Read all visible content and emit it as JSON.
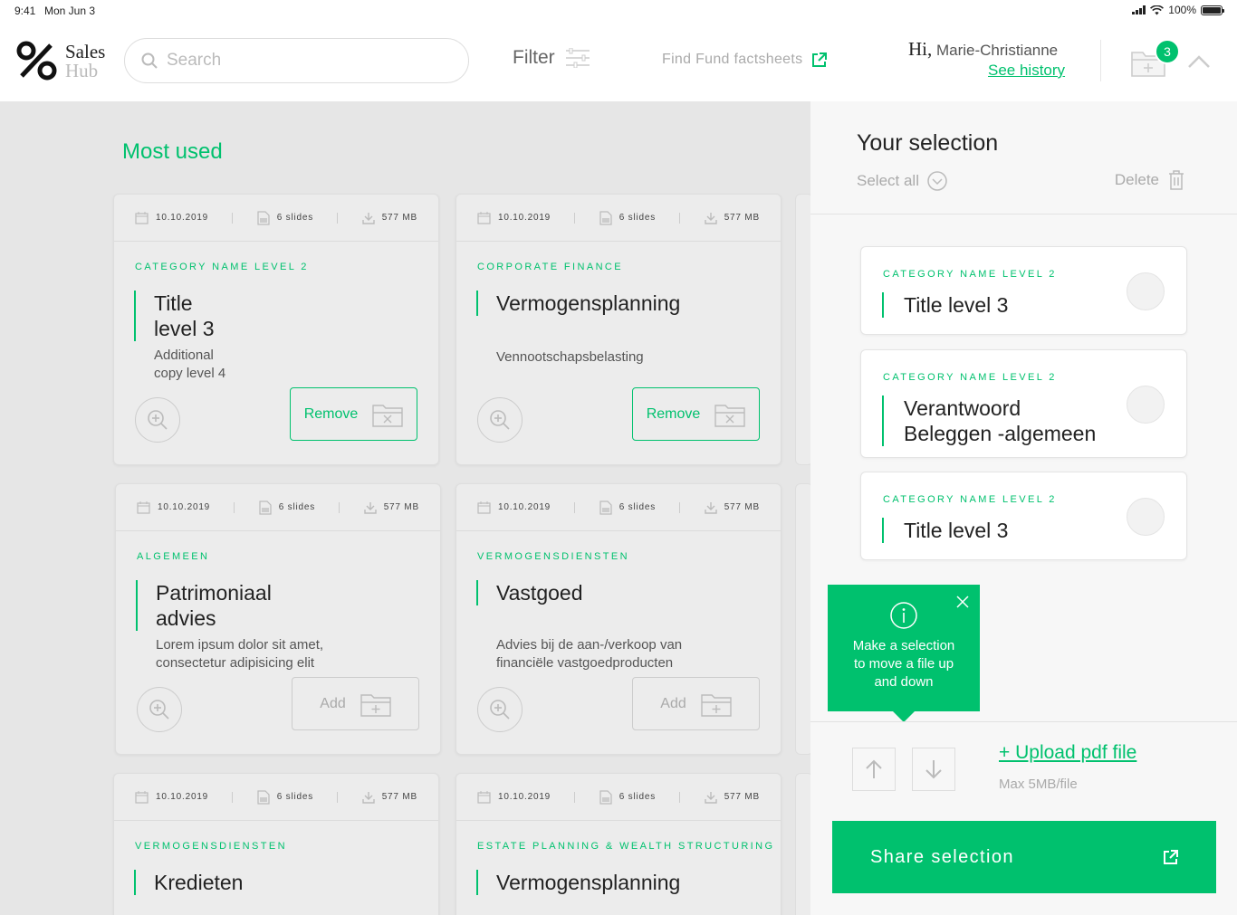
{
  "status_bar": {
    "time": "9:41",
    "date": "Mon Jun 3",
    "battery": "100%"
  },
  "header": {
    "brand_top": "Sales",
    "brand_bottom": "Hub",
    "search_placeholder": "Search",
    "filter_label": "Filter",
    "factsheets_label": "Find Fund factsheets",
    "greeting_hi": "Hi,",
    "user_name": "Marie-Christianne",
    "history_link": "See history",
    "cart_count": "3"
  },
  "main": {
    "section_title": "Most used",
    "cards": [
      {
        "date": "10.10.2019",
        "slides": "6 slides",
        "size": "577 MB",
        "category": "CATEGORY NAME LEVEL 2",
        "title_line1": "Title",
        "title_line2": "level 3",
        "desc_line1": "Additional",
        "desc_line2": "copy level 4",
        "action": "Remove"
      },
      {
        "date": "10.10.2019",
        "slides": "6 slides",
        "size": "577 MB",
        "category": "CORPORATE FINANCE",
        "title_line1": "Vermogensplanning",
        "title_line2": "",
        "desc_line1": "Vennootschapsbelasting",
        "desc_line2": "",
        "action": "Remove"
      },
      {
        "date": "10.10.2019",
        "slides": "6 slides",
        "size": "577 MB",
        "category": "ALGEMEEN",
        "title_line1": "Patrimoniaal",
        "title_line2": "advies",
        "desc_line1": "Lorem ipsum dolor sit amet,",
        "desc_line2": "consectetur adipisicing elit",
        "action": "Add"
      },
      {
        "date": "10.10.2019",
        "slides": "6 slides",
        "size": "577 MB",
        "category": "VERMOGENSDIENSTEN",
        "title_line1": "Vastgoed",
        "title_line2": "",
        "desc_line1": "Advies bij de aan-/verkoop van",
        "desc_line2": "financiële vastgoedproducten",
        "action": "Add"
      },
      {
        "date": "10.10.2019",
        "slides": "6 slides",
        "size": "577 MB",
        "category": "VERMOGENSDIENSTEN",
        "title_line1": "Kredieten",
        "title_line2": "",
        "desc_line1": "",
        "desc_line2": "",
        "action": ""
      },
      {
        "date": "10.10.2019",
        "slides": "6 slides",
        "size": "577 MB",
        "category": "ESTATE PLANNING & WEALTH STRUCTURING",
        "title_line1": "Vermogensplanning",
        "title_line2": "",
        "desc_line1": "",
        "desc_line2": "",
        "action": ""
      }
    ]
  },
  "panel": {
    "title": "Your selection",
    "select_all": "Select all",
    "delete": "Delete",
    "items": [
      {
        "category": "CATEGORY NAME LEVEL 2",
        "title_line1": "Title level 3",
        "title_line2": ""
      },
      {
        "category": "CATEGORY NAME LEVEL 2",
        "title_line1": "Verantwoord",
        "title_line2": "Beleggen -algemeen"
      },
      {
        "category": "CATEGORY NAME LEVEL 2",
        "title_line1": "Title level 3",
        "title_line2": ""
      }
    ],
    "tooltip_line1": "Make a selection",
    "tooltip_line2": "to move a file up",
    "tooltip_line3": "and down",
    "upload_link": "+ Upload pdf file",
    "max_size": "Max 5MB/file",
    "share_button": "Share selection"
  },
  "colors": {
    "accent": "#00c16e",
    "background": "#e6e6e6",
    "panel": "#f7f7f7"
  }
}
